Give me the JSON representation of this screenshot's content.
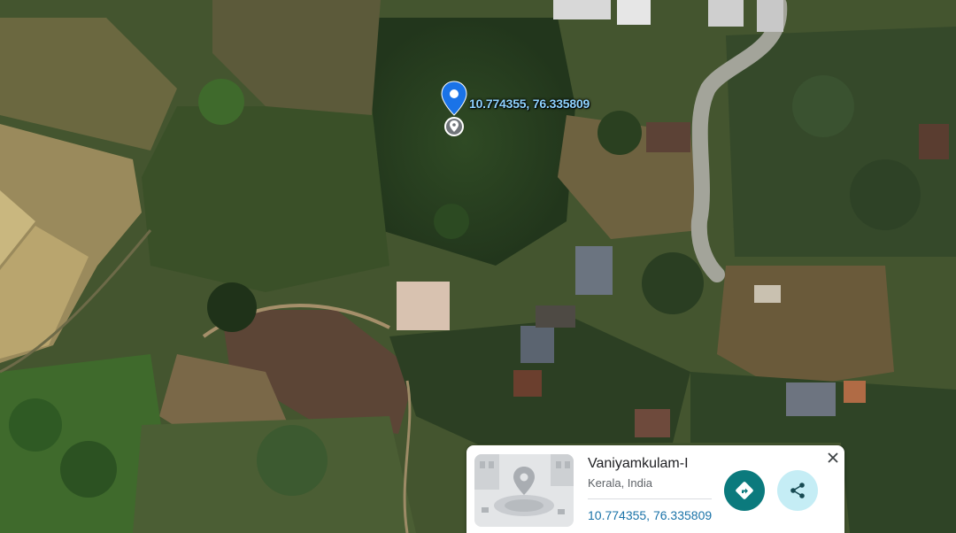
{
  "map": {
    "view": "satellite",
    "pin_color": "#1a73e8",
    "coordinate_label": "10.774355, 76.335809"
  },
  "place_card": {
    "name": "Vaniyamkulam-I",
    "region": "Kerala, India",
    "coordinates": "10.774355, 76.335809",
    "accent_color": "#0b7a7d",
    "icons": [
      "place-photo",
      "directions-icon",
      "share-icon",
      "close-icon"
    ]
  }
}
